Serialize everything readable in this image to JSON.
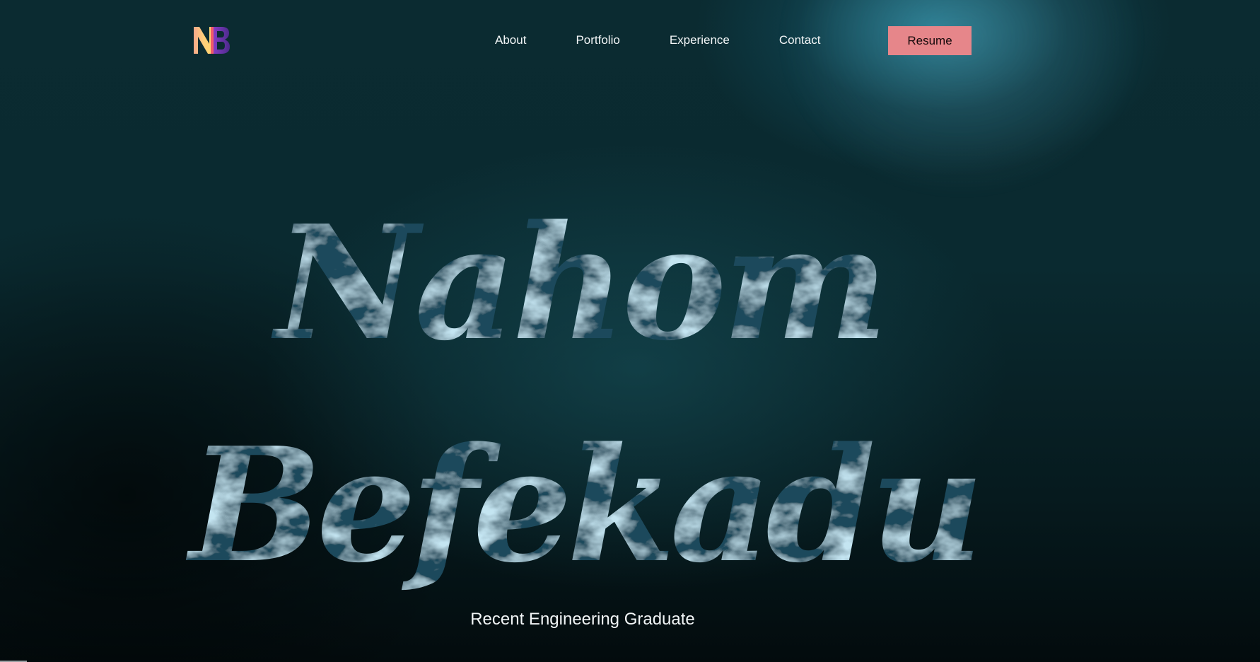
{
  "header": {
    "logo_text": "NB"
  },
  "nav": {
    "items": [
      {
        "label": "About"
      },
      {
        "label": "Portfolio"
      },
      {
        "label": "Experience"
      },
      {
        "label": "Contact"
      }
    ],
    "resume_label": "Resume"
  },
  "hero": {
    "first_name": "Nahom",
    "last_name": "Befekadu",
    "tagline": "Recent Engineering Graduate"
  },
  "colors": {
    "accent_button": "#e6868a",
    "background": "#0a2a30",
    "text": "#f4f7f8"
  }
}
